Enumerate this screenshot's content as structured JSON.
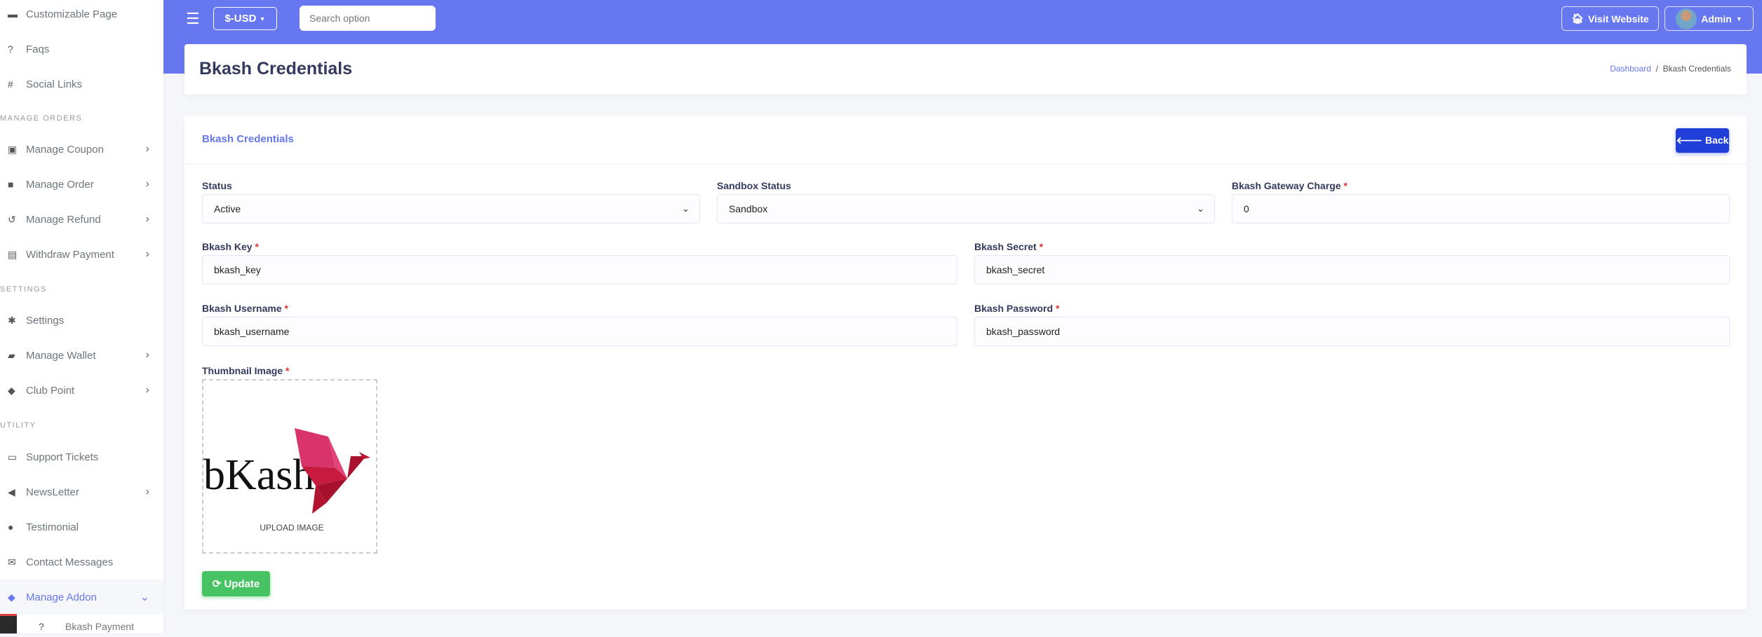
{
  "sidebar": {
    "items": [
      {
        "label": "Customizable Page",
        "icon": "▬"
      },
      {
        "label": "Faqs",
        "icon": "?"
      },
      {
        "label": "Social Links",
        "icon": "#"
      },
      {
        "label": "Manage Coupon",
        "icon": "▣"
      },
      {
        "label": "Manage Order",
        "icon": "■"
      },
      {
        "label": "Manage Refund",
        "icon": "↺"
      },
      {
        "label": "Withdraw Payment",
        "icon": "▤"
      },
      {
        "label": "Settings",
        "icon": "✱"
      },
      {
        "label": "Manage Wallet",
        "icon": "▰"
      },
      {
        "label": "Club Point",
        "icon": "◆"
      },
      {
        "label": "Support Tickets",
        "icon": "▭"
      },
      {
        "label": "NewsLetter",
        "icon": "◀"
      },
      {
        "label": "Testimonial",
        "icon": "●"
      },
      {
        "label": "Contact Messages",
        "icon": "✉"
      },
      {
        "label": "Manage Addon",
        "icon": "◆"
      }
    ],
    "headers": [
      "MANAGE ORDERS",
      "SETTINGS",
      "UTILITY"
    ],
    "sub_item": "Bkash Payment"
  },
  "topbar": {
    "currency": "$-USD",
    "search_placeholder": "Search option",
    "visit_website": "Visit Website",
    "user": "Admin"
  },
  "header": {
    "title": "Bkash Credentials",
    "breadcrumb": [
      "Dashboard",
      "Bkash Credentials"
    ]
  },
  "form": {
    "card_title": "Bkash Credentials",
    "back": "Back",
    "status": {
      "label": "Status",
      "value": "Active"
    },
    "sandbox": {
      "label": "Sandbox Status",
      "value": "Sandbox"
    },
    "charge": {
      "label": "Bkash Gateway Charge",
      "value": "0"
    },
    "key": {
      "label": "Bkash Key",
      "value": "bkash_key"
    },
    "secret": {
      "label": "Bkash Secret",
      "value": "bkash_secret"
    },
    "username": {
      "label": "Bkash Username",
      "value": "bkash_username"
    },
    "password": {
      "label": "Bkash Password",
      "value": "bkash_password"
    },
    "thumbnail": {
      "label": "Thumbnail Image",
      "upload": "UPLOAD IMAGE",
      "logo_text": "bKash"
    },
    "required_mark": "*",
    "update": "Update"
  },
  "colors": {
    "primary": "#6777ef",
    "back": "#1f3fd8",
    "success": "#47c363"
  }
}
